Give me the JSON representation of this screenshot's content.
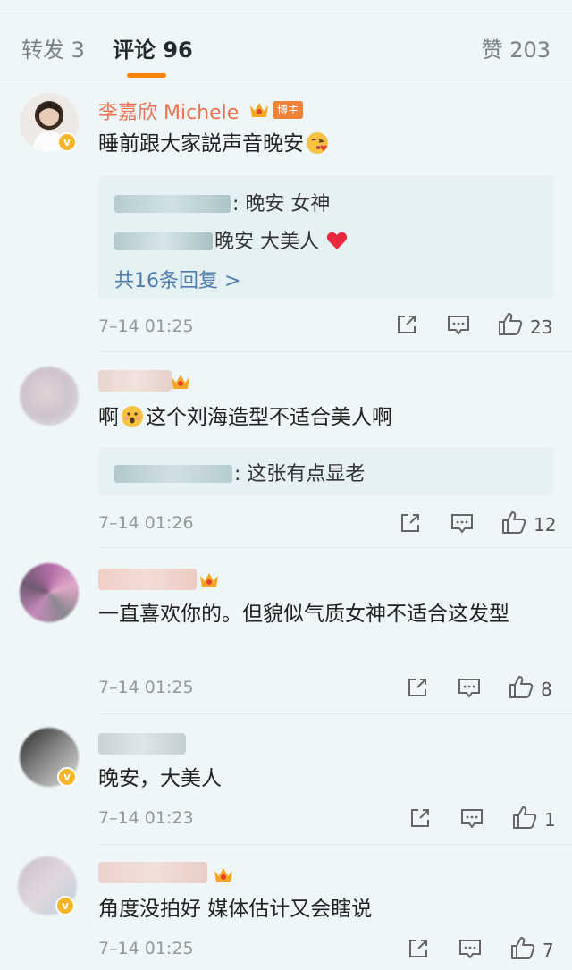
{
  "tabs": {
    "repost": "转发 3",
    "comments": "评论 96",
    "likes": "赞 203"
  },
  "colors": {
    "accent": "#ff8200",
    "author": "#eb7350",
    "link": "#507daf"
  },
  "comments": [
    {
      "author": "李嘉欣 Michele",
      "host_tag": "博主",
      "text": "睡前跟大家説声音晚安",
      "emoji": "kiss-emoji",
      "replies": [
        ": 晚安 女神",
        "晚安 大美人"
      ],
      "more_replies": "共16条回复 >",
      "time": "7–14 01:25",
      "likes": "23"
    },
    {
      "text": "啊",
      "text_after": "这个刘海造型不适合美人啊",
      "emoji": "surprised-emoji",
      "replies": [
        ": 这张有点显老"
      ],
      "time": "7–14 01:26",
      "likes": "12"
    },
    {
      "text": "一直喜欢你的。但貌似气质女神不适合这发型",
      "time": "7–14 01:25",
      "likes": "8"
    },
    {
      "text": "晚安，大美人",
      "time": "7–14 01:23",
      "likes": "1"
    },
    {
      "text": "角度没拍好 媒体估计又会瞎说",
      "time": "7–14 01:25",
      "likes": "7"
    }
  ]
}
